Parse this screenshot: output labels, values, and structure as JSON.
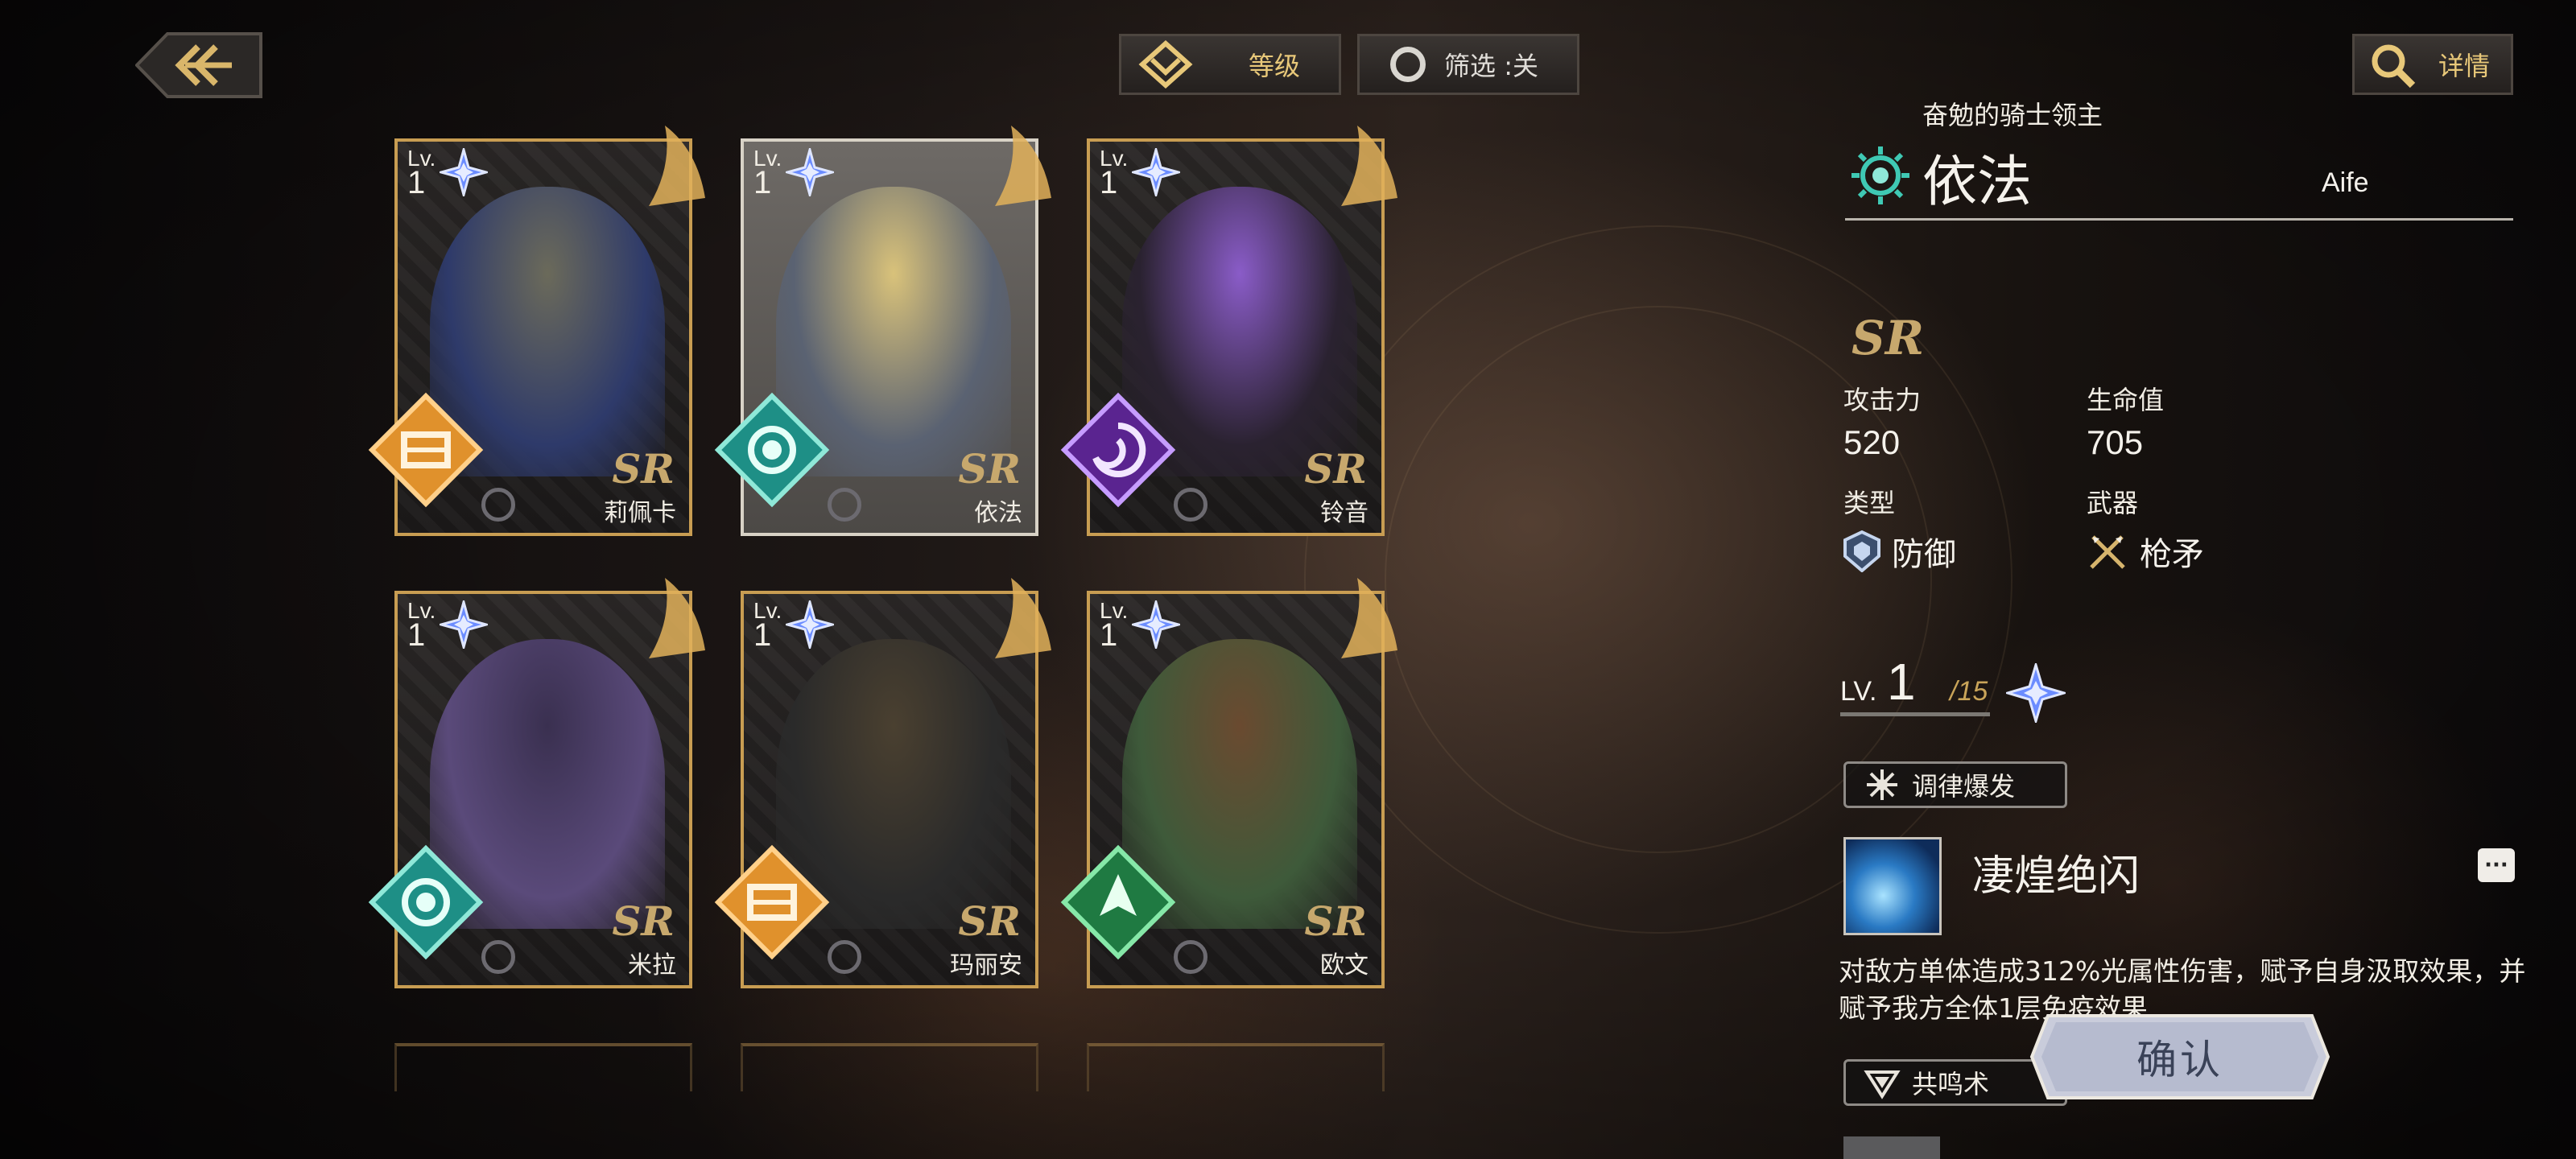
{
  "topbar": {
    "sort_label": "等级",
    "filter_label": "筛选 :关",
    "detail_label": "详情"
  },
  "cards": [
    {
      "lv_prefix": "Lv.",
      "level": "1",
      "name": "莉佩卡",
      "rank": "SR",
      "element": "orange-seal",
      "selected": false
    },
    {
      "lv_prefix": "Lv.",
      "level": "1",
      "name": "依法",
      "rank": "SR",
      "element": "light-sun",
      "selected": true
    },
    {
      "lv_prefix": "Lv.",
      "level": "1",
      "name": "铃音",
      "rank": "SR",
      "element": "purple-swirl",
      "selected": false
    },
    {
      "lv_prefix": "Lv.",
      "level": "1",
      "name": "米拉",
      "rank": "SR",
      "element": "light-sun",
      "selected": false
    },
    {
      "lv_prefix": "Lv.",
      "level": "1",
      "name": "玛丽安",
      "rank": "SR",
      "element": "orange-seal",
      "selected": false
    },
    {
      "lv_prefix": "Lv.",
      "level": "1",
      "name": "欧文",
      "rank": "SR",
      "element": "green-leaf",
      "selected": false
    }
  ],
  "detail": {
    "title": "奋勉的骑士领主",
    "name_cn": "依法",
    "name_en": "Aife",
    "rank": "SR",
    "attack_label": "攻击力",
    "attack_value": "520",
    "hp_label": "生命值",
    "hp_value": "705",
    "type_label": "类型",
    "type_value": "防御",
    "weapon_label": "武器",
    "weapon_value": "枪矛",
    "lv_prefix": "LV.",
    "level": "1",
    "level_max": "/15",
    "burst_tag": "调律爆发",
    "skill_name": "凄煌绝闪",
    "skill_desc": "对敌方单体造成312%光属性伤害，赋予自身汲取效果，并赋予我方全体1层免疫效果",
    "resonance_tag": "共鸣术",
    "more_label": "···"
  },
  "confirm_label": "确认",
  "colors": {
    "gold": "#c89d52",
    "rank_gold": "#c7a86d",
    "text_gold": "#e8c879",
    "light_element": "#3fc9b4",
    "orange_element": "#e0912c",
    "purple_element": "#8a3ad0",
    "green_element": "#2ea85a",
    "star_blue": "#6b8cff"
  }
}
